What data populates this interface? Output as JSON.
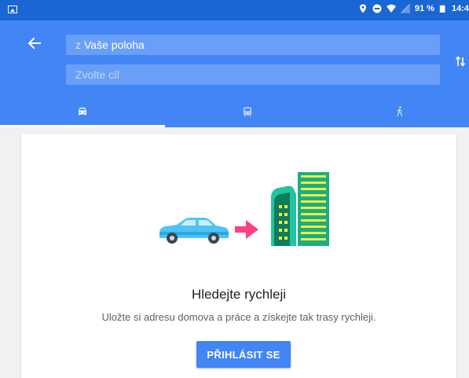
{
  "status_bar": {
    "battery": "91 %",
    "time": "14:4",
    "icons": [
      "gallery-icon",
      "location-icon",
      "do-not-disturb-icon",
      "wifi-icon",
      "no-sim-icon",
      "battery-icon"
    ]
  },
  "header": {
    "from_prefix": "z",
    "from_value": "Vaše poloha",
    "to_placeholder": "Zvolte cíl",
    "icons": [
      "back-arrow-icon",
      "swap-icon"
    ]
  },
  "tabs": [
    {
      "name": "driving",
      "icon": "car-icon",
      "selected": true
    },
    {
      "name": "transit",
      "icon": "train-icon",
      "selected": false
    },
    {
      "name": "walking",
      "icon": "walk-icon",
      "selected": false
    }
  ],
  "card": {
    "title": "Hledejte rychleji",
    "subtitle": "Uložte si adresu domova a práce a získejte tak trasy rychleji.",
    "button": "PŘIHLÁSIT SE"
  },
  "colors": {
    "status_bar": "#1a66d3",
    "header": "#4285f4",
    "button": "#4285f4",
    "arrow": "#ff4081",
    "car": "#4fc3f7",
    "building": "#22c4a0"
  }
}
